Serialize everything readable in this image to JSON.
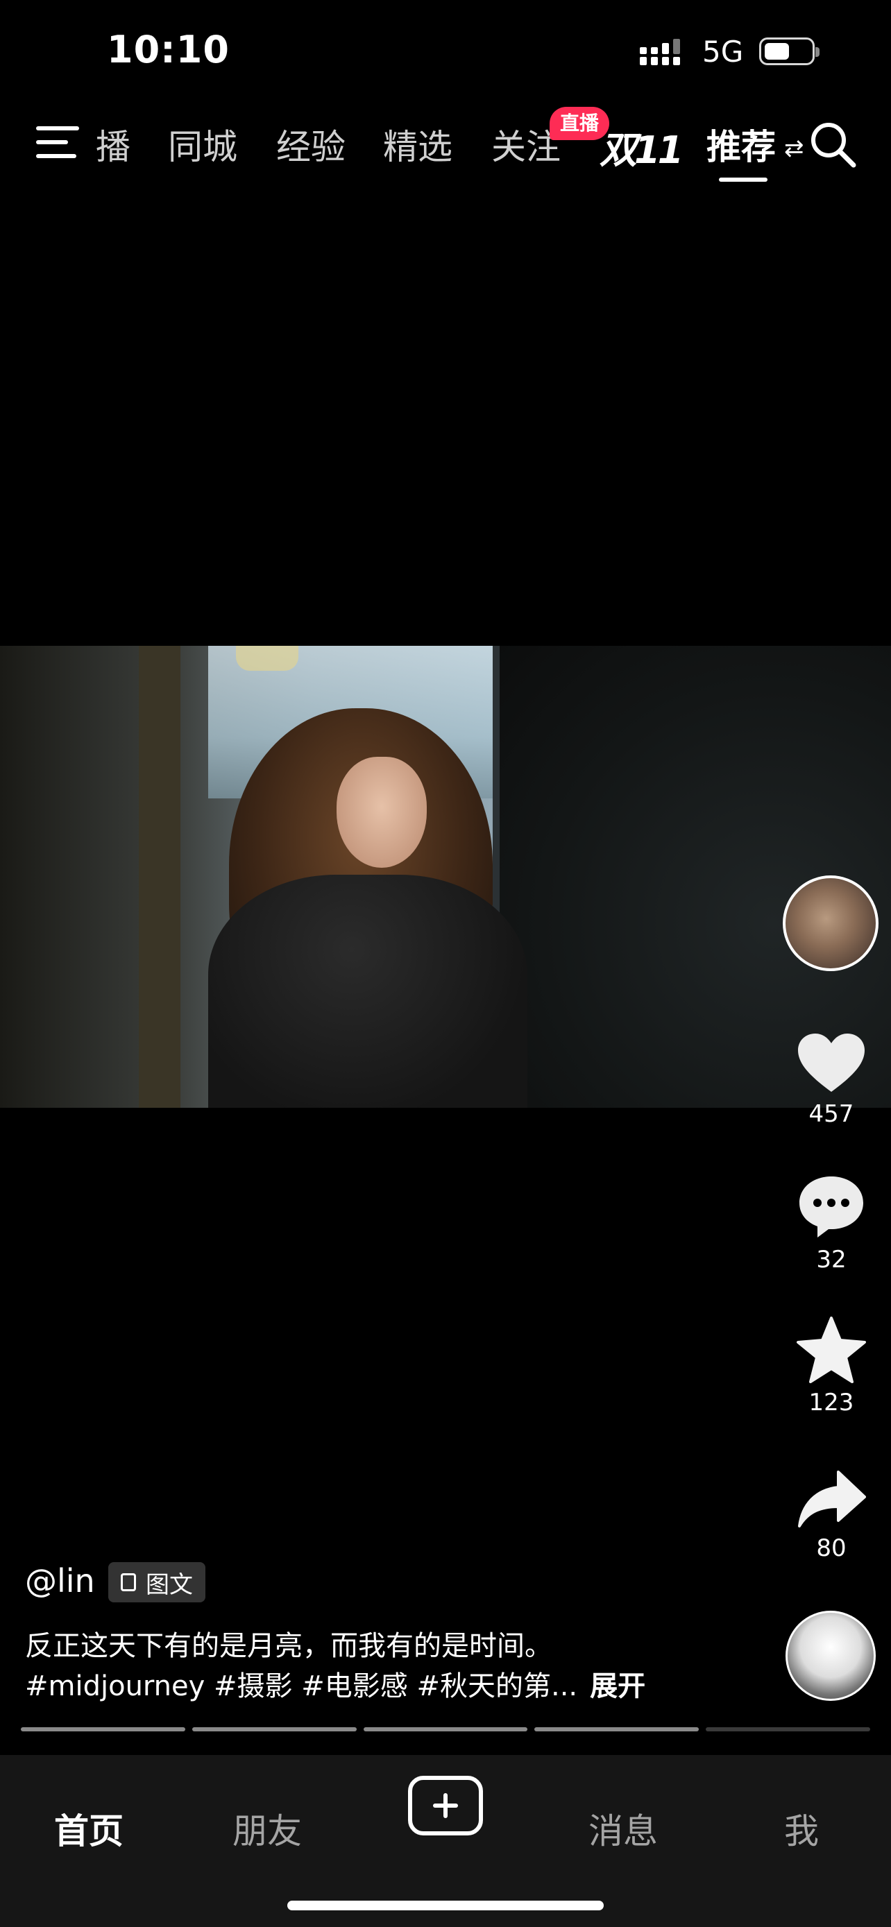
{
  "status_bar": {
    "time": "10:10",
    "network": "5G",
    "battery_level": 0.55
  },
  "top_nav": {
    "tabs": [
      "播",
      "同城",
      "经验",
      "精选",
      "关注",
      "推荐"
    ],
    "live_badge": "直播",
    "double11_logo": "双11",
    "active_tab": "推荐"
  },
  "post": {
    "author": "@lin",
    "type_badge": "图文",
    "caption": "反正这天下有的是月亮，而我有的是时间。",
    "tags": "#midjourney #摄影 #电影感 #秋天的第...",
    "expand_label": "展开"
  },
  "actions": {
    "likes": "457",
    "comments": "32",
    "favorites": "123",
    "shares": "80"
  },
  "progress": {
    "total_segments": 5,
    "current_segment": 4
  },
  "bottom_nav": {
    "home": "首页",
    "friends": "朋友",
    "messages": "消息",
    "me": "我"
  },
  "icons": [
    "menu-icon",
    "search-icon",
    "heart-icon",
    "comment-icon",
    "star-icon",
    "share-icon",
    "add-icon",
    "signal-icon",
    "battery-icon"
  ]
}
